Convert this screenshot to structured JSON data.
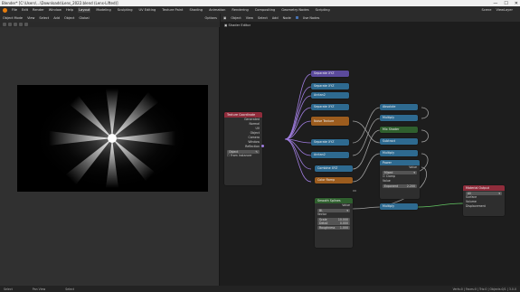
{
  "window": {
    "title": "Blender* [C:\\Users\\...\\Downloads\\Lens_2022.blend (Lens-Lifted)]",
    "controls": [
      "—",
      "☐",
      "✕"
    ]
  },
  "menubar": {
    "menus": [
      "File",
      "Edit",
      "Render",
      "Window",
      "Help"
    ],
    "tabs": [
      "Layout",
      "Modeling",
      "Sculpting",
      "UV Editing",
      "Texture Paint",
      "Shading",
      "Animation",
      "Rendering",
      "Compositing",
      "Geometry Nodes",
      "Scripting"
    ],
    "active_tab": "Layout",
    "scene": "Scene",
    "view_layer": "ViewLayer"
  },
  "left_editor": {
    "mode": "Object Mode",
    "menus": [
      "View",
      "Select",
      "Add",
      "Object"
    ],
    "shading": "Global",
    "options": "Options"
  },
  "right_editor": {
    "menus": [
      "Object",
      "View",
      "Select",
      "Add",
      "Node"
    ],
    "use_nodes": "Use Nodes",
    "breadcrumb": "Shader Editor"
  },
  "nodes": {
    "texcoord": {
      "title": "Texture Coordinate",
      "outputs": [
        "Generated",
        "Normal",
        "UV",
        "Object",
        "Camera",
        "Window",
        "Reflection"
      ],
      "object_label": "Object",
      "from_instancer": "From Instancer"
    },
    "small": [
      {
        "id": "n1",
        "title": "Separate XYZ"
      },
      {
        "id": "n2",
        "title": "Separate XYZ"
      },
      {
        "id": "n3",
        "title": "Arctan2"
      },
      {
        "id": "n4",
        "title": "Separate XYZ"
      },
      {
        "id": "n5",
        "title": "Noise Texture"
      },
      {
        "id": "n6",
        "title": "Separate XYZ"
      },
      {
        "id": "n7",
        "title": "Arctan2"
      },
      {
        "id": "n8",
        "title": "Combine XYZ"
      },
      {
        "id": "n9",
        "title": "Color Ramp"
      },
      {
        "id": "n10",
        "title": "Absolute"
      },
      {
        "id": "n11",
        "title": "Multiply"
      },
      {
        "id": "n12",
        "title": "Mix Shader"
      },
      {
        "id": "n13",
        "title": "Subtract"
      },
      {
        "id": "n14",
        "title": "Multiply"
      },
      {
        "id": "n15",
        "title": "Power"
      },
      {
        "id": "n16",
        "title": "Multiply"
      }
    ],
    "mix": {
      "title": "Emission",
      "mode": "Mixed",
      "clamp": "Clamp",
      "value_label": "Value",
      "factor_label": "Exponent",
      "factor_value": "2.200"
    },
    "gradient": {
      "title": "Smooth Splines",
      "output": "Value",
      "dropdown": "Bl.",
      "vector_label": "Vector",
      "fields": [
        {
          "label": "Scale",
          "value": "10.000"
        },
        {
          "label": "Detail",
          "value": "0.000"
        },
        {
          "label": "Roughness",
          "value": "1.000"
        }
      ]
    },
    "emission_small": {
      "title": "Emission"
    },
    "output": {
      "title": "Material Output",
      "target": "All",
      "inputs": [
        "Surface",
        "Volume",
        "Displacement"
      ]
    }
  },
  "statusbar": {
    "items": [
      "Select",
      "Pan View",
      "Select"
    ],
    "version": "Verts:0 | Faces:0 | Tris:0 | Objects:0/1 | 3.0.0"
  },
  "colors": {
    "accent": "#4772b3",
    "brand": "#e87d0d"
  }
}
